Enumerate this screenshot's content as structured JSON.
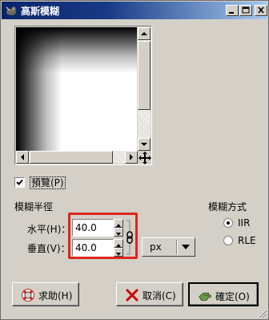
{
  "window": {
    "title": "高斯模糊",
    "icons": {
      "app": "gimp-wilber-icon",
      "minimize": "minimize-icon",
      "maximize": "maximize-icon",
      "close": "close-icon"
    }
  },
  "preview": {
    "checkbox_label": "預覽(P)",
    "checked": true,
    "nav_icon": "move-cross-icon"
  },
  "blur_radius": {
    "heading": "模糊半徑",
    "horizontal_label": "水平(H)：",
    "vertical_label": "垂直(V)：",
    "horizontal_value": "40.0",
    "vertical_value": "40.0",
    "chain_icon": "chain-link-icon",
    "unit": "px"
  },
  "blur_method": {
    "heading": "模糊方式",
    "options": [
      "IIR",
      "RLE"
    ],
    "selected": "IIR"
  },
  "buttons": {
    "help": "求助(H)",
    "cancel": "取消(C)",
    "ok": "確定(O)"
  },
  "colors": {
    "titlebar_start": "#0a246a",
    "titlebar_end": "#a6caf0",
    "dialog_bg": "#d4d0c8",
    "highlight": "#e0251b"
  }
}
